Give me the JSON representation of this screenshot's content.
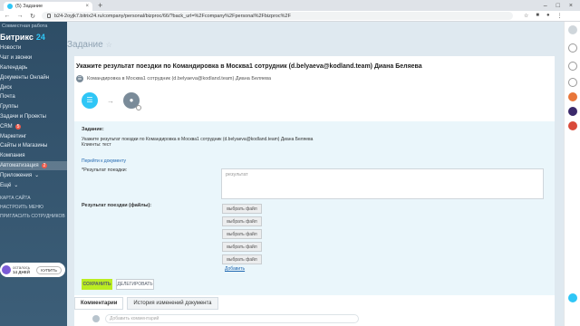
{
  "browser": {
    "tab_title": "(5) Задание",
    "tab_close": "×",
    "new_tab": "+",
    "window_controls": [
      "–",
      "□",
      "×"
    ],
    "url": "b24-2oyjk7.bitrix24.ru/company/personal/bizproc/66/?back_url=%2Fcompany%2Fpersonal%2Fbizproc%2F"
  },
  "sidebar": {
    "top_text": "Совместная работа",
    "logo_text": "Битрикс",
    "logo_num": "24",
    "items": [
      {
        "label": "Новости"
      },
      {
        "label": "Чат и звонки"
      },
      {
        "label": "Календарь"
      },
      {
        "label": "Документы Онлайн"
      },
      {
        "label": "Диск"
      },
      {
        "label": "Почта"
      },
      {
        "label": "Группы"
      },
      {
        "label": "Задачи и Проекты"
      },
      {
        "label": "CRM",
        "badge": "5"
      },
      {
        "label": "Маркетинг"
      },
      {
        "label": "Сайты и Магазины"
      },
      {
        "label": "Компания"
      },
      {
        "label": "Автоматизация",
        "badge": "2"
      },
      {
        "label": "Приложения"
      },
      {
        "label": "Ещё"
      }
    ],
    "small_items": [
      "КАРТА САЙТА",
      "НАСТРОИТЬ МЕНЮ",
      "ПРИГЛАСИТЬ СОТРУДНИКОВ"
    ],
    "tariff_line1": "осталось",
    "tariff_line2": "14 ДНЕЙ",
    "tariff_button": "КУПИТЬ"
  },
  "page": {
    "title": "Задание",
    "star": "☆"
  },
  "task": {
    "title": "Укажите результат поездки по Командировка в Москва1 сотрудник (d.belyaeva@kodland.team) Диана Беляева",
    "subtitle": "Командировка в Москва1 сотрудник (d.belyaeva@kodland.team) Диана Беляева",
    "flow_arrow": "→",
    "form": {
      "section_label": "Задание:",
      "description_line1": "Укажите результат поездки по Командировка в Москва1 сотрудник (d.belyaeva@kodland.team) Диана Беляева",
      "description_line2": "Клиенты: тест",
      "doc_link": "Перейти к документу",
      "result_label": "*Результат поездки:",
      "result_placeholder": "результат",
      "files_label": "Результат поездки (файлы):",
      "file_buttons": [
        "выбрать файл",
        "выбрать файл",
        "выбрать файл",
        "выбрать файл",
        "выбрать файл"
      ],
      "add_link": "Добавить"
    },
    "buttons": {
      "save": "СОХРАНИТЬ",
      "delegate": "ДЕЛЕГИРОВАТЬ"
    },
    "tabs": [
      "Комментарии",
      "История изменений документа"
    ],
    "comment_placeholder": "Добавить комментарий"
  },
  "colors": {
    "accent": "#2fc6f6",
    "save_button": "#bbed21",
    "badge": "#f05a4a",
    "form_bg": "#eaf6fb"
  }
}
